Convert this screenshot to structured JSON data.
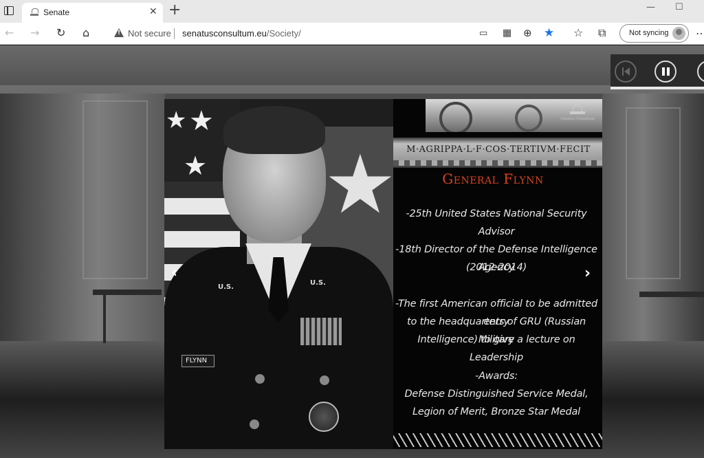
{
  "browser": {
    "tab_title": "Senate",
    "tab_close": "✕",
    "new_tab": "+",
    "security_label": "Not secure",
    "url_domain": "senatusconsultum.eu",
    "url_path": "/Society/",
    "sync_label": "Not syncing",
    "icons": {
      "back": "←",
      "forward": "→",
      "refresh": "↻",
      "home": "⌂",
      "read_aloud": "▭",
      "apps": "▦",
      "zoom": "⊕",
      "favorite": "★",
      "favorites_list": "☆",
      "collections": "⧉",
      "more": "⋯",
      "minimize": "—",
      "maximize": "☐"
    },
    "colors": {
      "favorite_star": "#1a73e8"
    }
  },
  "media": {
    "skip_back": "skip-back-icon",
    "pause": "pause-icon"
  },
  "slide": {
    "nav_prev": "‹",
    "nav_next": "›",
    "photo_name_tag": "FLYNN",
    "photo_pin_left": "U.S.",
    "photo_pin_right": "U.S.",
    "logo_caption": "Senatus Consultum",
    "frieze_inscription": "M·AGRIPPA·L·F·COS·TERTIVM·FECIT",
    "heading": "General Flynn",
    "lines": [
      "-25th United States National Security Advisor",
      "-18th Director of the Defense Intelligence Agency",
      "(2012-2014)",
      "-The first American official to be admitted entry",
      "to the headquarters of GRU (Russian Military",
      "Intelligence) to give a lecture on Leadership",
      "-Awards:",
      "Defense Distinguished Service Medal,",
      "Legion of Merit, Bronze Star Medal"
    ],
    "colors": {
      "heading": "#d9441f",
      "text": "#e9e9e9",
      "panel": "#050505"
    }
  }
}
